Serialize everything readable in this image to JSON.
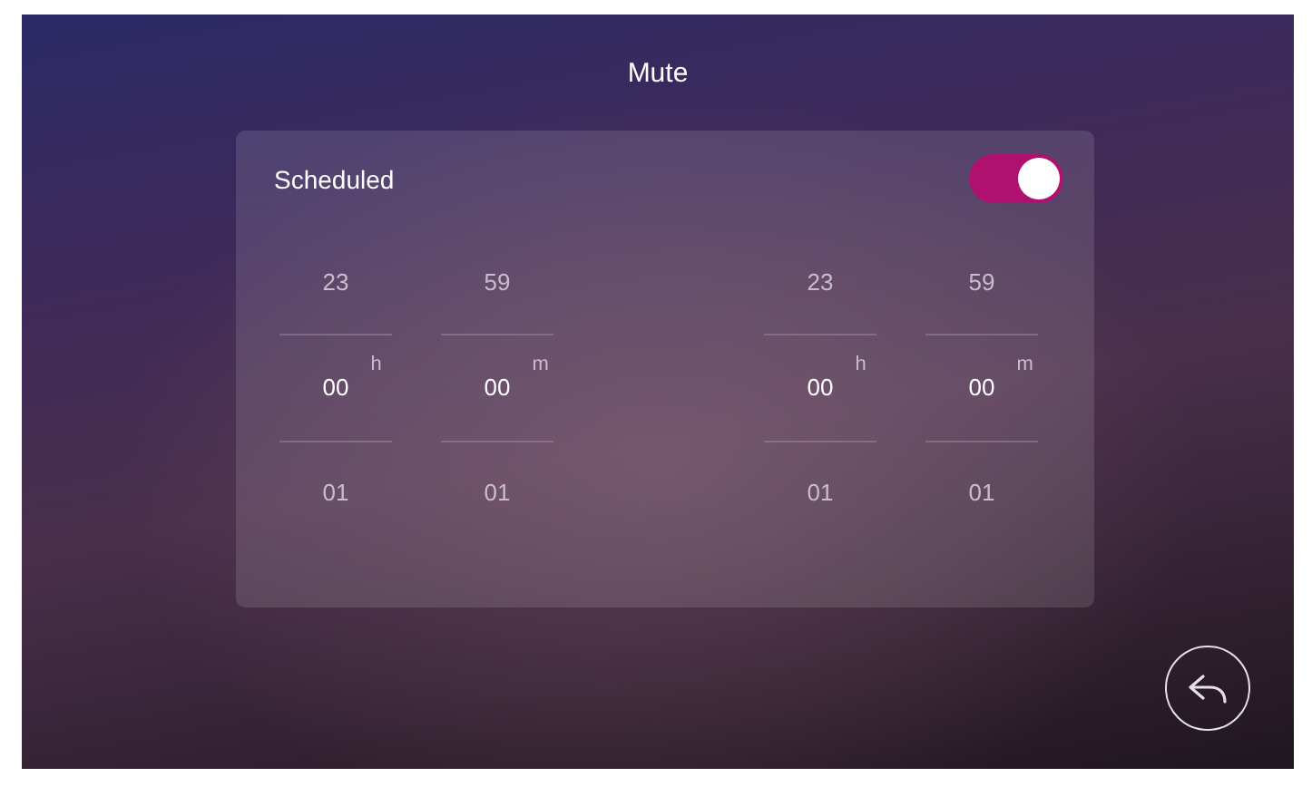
{
  "title": "Mute",
  "schedule": {
    "label": "Scheduled",
    "on": true
  },
  "pickers": [
    {
      "columns": [
        {
          "above": "23",
          "value": "00",
          "below": "01",
          "unit": "h"
        },
        {
          "above": "59",
          "value": "00",
          "below": "01",
          "unit": "m"
        }
      ]
    },
    {
      "columns": [
        {
          "above": "23",
          "value": "00",
          "below": "01",
          "unit": "h"
        },
        {
          "above": "59",
          "value": "00",
          "below": "01",
          "unit": "m"
        }
      ]
    }
  ]
}
